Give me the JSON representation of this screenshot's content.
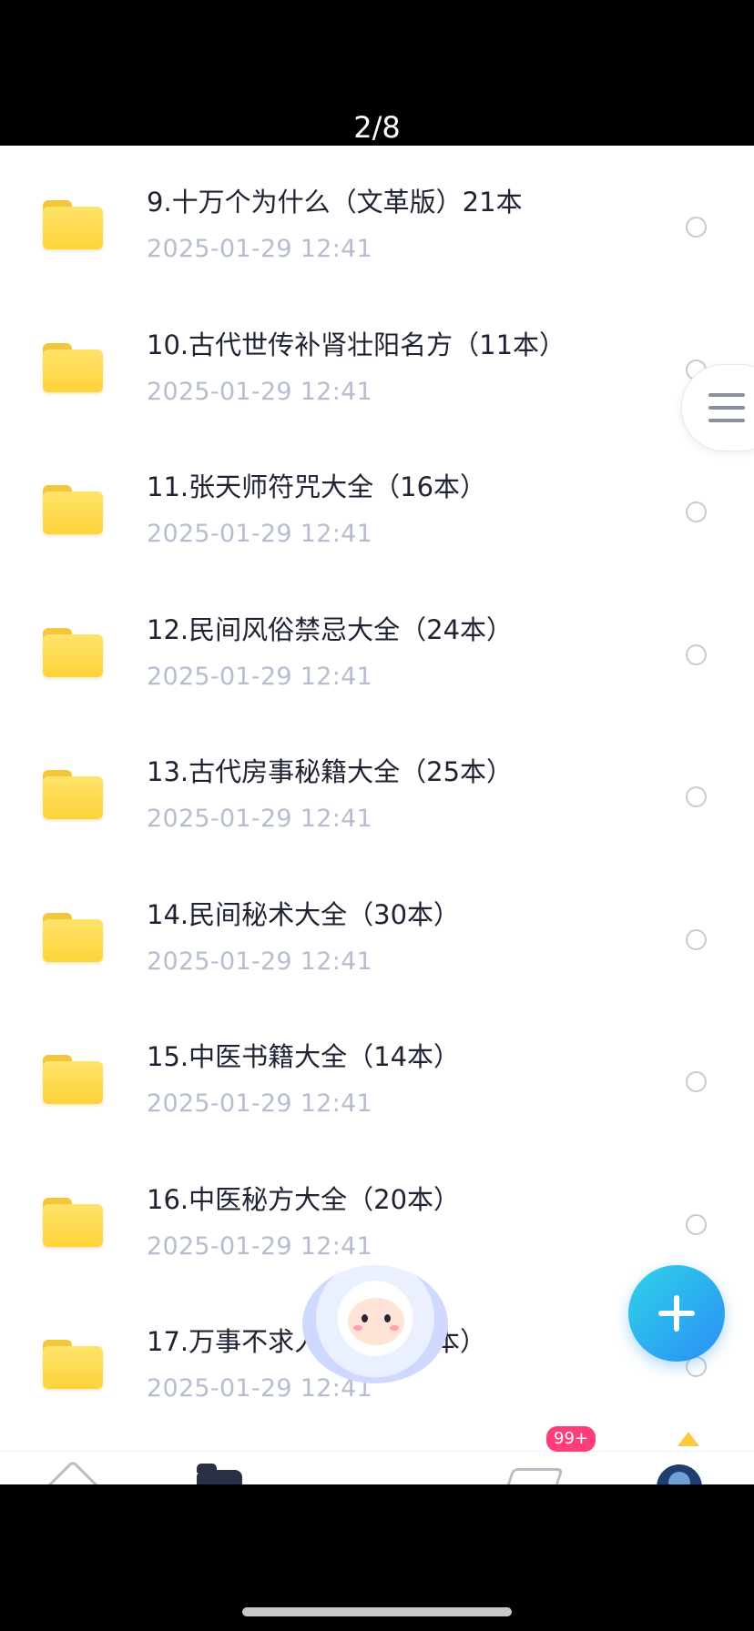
{
  "header": {
    "page_counter": "2/8"
  },
  "files": [
    {
      "title": "9.十万个为什么（文革版）21本",
      "date": "2025-01-29  12:41"
    },
    {
      "title": "10.古代世传补肾壮阳名方（11本）",
      "date": "2025-01-29  12:41"
    },
    {
      "title": "11.张天师符咒大全（16本）",
      "date": "2025-01-29  12:41"
    },
    {
      "title": "12.民间风俗禁忌大全（24本）",
      "date": "2025-01-29  12:41"
    },
    {
      "title": "13.古代房事秘籍大全（25本）",
      "date": "2025-01-29  12:41"
    },
    {
      "title": "14.民间秘术大全（30本）",
      "date": "2025-01-29  12:41"
    },
    {
      "title": "15.中医书籍大全（14本）",
      "date": "2025-01-29  12:41"
    },
    {
      "title": "16.中医秘方大全（20本）",
      "date": "2025-01-29  12:41"
    },
    {
      "title": "17.万事不求人大全（24本）",
      "date": "2025-01-29  12:41"
    }
  ],
  "bottom_nav": {
    "messages_badge": "99+"
  },
  "icons": {
    "folder": "folder-icon",
    "menu": "hamburger-menu-icon",
    "add": "plus-icon",
    "home": "home-icon",
    "files": "files-icon",
    "messages": "send-icon",
    "profile": "profile-icon"
  },
  "colors": {
    "folder": "#fdd33b",
    "fab": "#2a8ff5",
    "badge": "#ff3d78",
    "date_text": "#b6bdd0"
  }
}
